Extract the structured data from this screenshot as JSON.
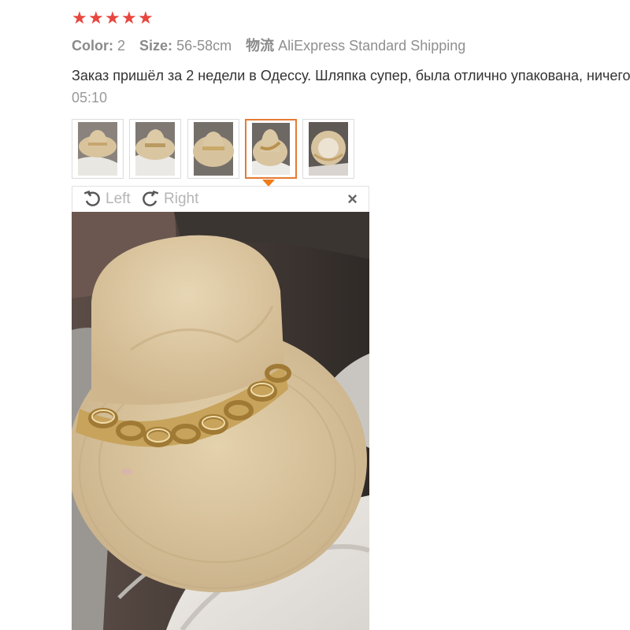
{
  "review": {
    "rating": 5,
    "meta": {
      "color_label": "Color:",
      "color_value": "2",
      "size_label": "Size:",
      "size_value": "56-58cm",
      "shipping_label": "物流",
      "shipping_value": "AliExpress Standard Shipping"
    },
    "text": "Заказ пришёл за 2 недели в Одессу. Шляпка супер, была отлично упакована, ничего",
    "time": "05:10"
  },
  "thumbnails": {
    "count": 5,
    "active_index": 3
  },
  "viewer": {
    "rotate_left_label": "Left",
    "rotate_right_label": "Right",
    "close_label": "×"
  },
  "colors": {
    "star": "#e8463e",
    "active_border": "#e57a35",
    "muted_text": "#b5b5b5"
  }
}
